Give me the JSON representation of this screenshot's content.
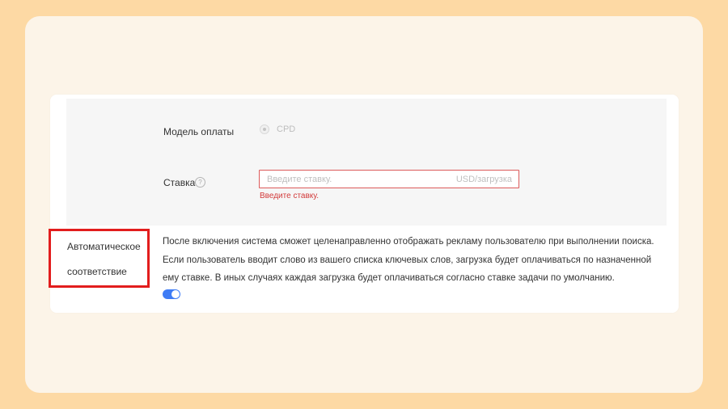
{
  "form": {
    "payment_model": {
      "label": "Модель оплаты",
      "option": "CPD",
      "selected": true
    },
    "bid": {
      "label": "Ставка",
      "help_icon": "?",
      "placeholder": "Введите ставку.",
      "unit": "USD/загрузка",
      "error": "Введите ставку."
    },
    "auto_match": {
      "label_line1": "Автоматическое",
      "label_line2": "соответствие",
      "description_line1": "После включения система сможет целенаправленно отображать рекламу пользователю при выполнении поиска.",
      "description_line2": "Если пользователь вводит слово из вашего списка ключевых слов, загрузка будет оплачиваться по назначенной",
      "description_line3": "ему ставке. В иных случаях каждая загрузка будет оплачиваться согласно ставке задачи по умолчанию.",
      "enabled": true
    }
  },
  "colors": {
    "background": "#fdd9a4",
    "card": "#fcf4e8",
    "error": "#d23a3a",
    "highlight_box": "#e21d1d",
    "toggle_on": "#3f7cf5"
  }
}
